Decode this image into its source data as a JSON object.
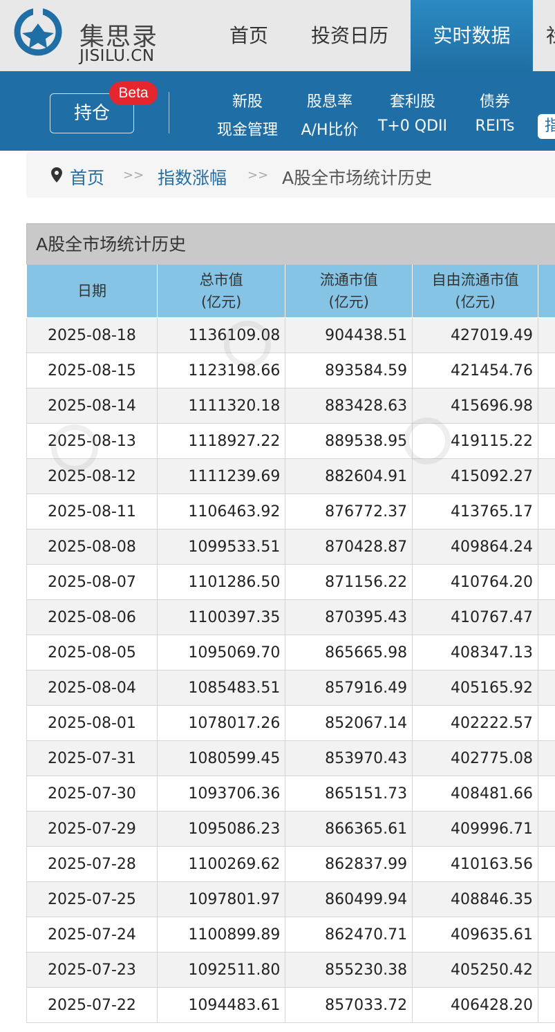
{
  "brand": {
    "name_cn": "集思录",
    "name_en": "JISILU.CN"
  },
  "top_nav": [
    {
      "label": "首页",
      "active": false
    },
    {
      "label": "投资日历",
      "active": false
    },
    {
      "label": "实时数据",
      "active": true
    },
    {
      "label": "社",
      "active": false
    }
  ],
  "sub_nav": {
    "hold_button": "持仓",
    "beta_badge": "Beta",
    "row1": [
      "新股",
      "股息率",
      "套利股",
      "债券"
    ],
    "row2": [
      "现金管理",
      "A/H比价",
      "T+0 QDII",
      "REITs"
    ],
    "pill": "指"
  },
  "breadcrumb": {
    "home": "首页",
    "sep": ">>",
    "section": "指数涨幅",
    "current": "A股全市场统计历史"
  },
  "table": {
    "caption": "A股全市场统计历史",
    "headers": [
      {
        "line1": "日期",
        "line2": ""
      },
      {
        "line1": "总市值",
        "line2": "(亿元)"
      },
      {
        "line1": "流通市值",
        "line2": "(亿元)"
      },
      {
        "line1": "自由流通市值",
        "line2": "(亿元)"
      }
    ],
    "rows": [
      [
        "2025-08-18",
        "1136109.08",
        "904438.51",
        "427019.49"
      ],
      [
        "2025-08-15",
        "1123198.66",
        "893584.59",
        "421454.76"
      ],
      [
        "2025-08-14",
        "1111320.18",
        "883428.63",
        "415696.98"
      ],
      [
        "2025-08-13",
        "1118927.22",
        "889538.95",
        "419115.22"
      ],
      [
        "2025-08-12",
        "1111239.69",
        "882604.91",
        "415092.27"
      ],
      [
        "2025-08-11",
        "1106463.92",
        "876772.37",
        "413765.17"
      ],
      [
        "2025-08-08",
        "1099533.51",
        "870428.87",
        "409864.24"
      ],
      [
        "2025-08-07",
        "1101286.50",
        "871156.22",
        "410764.20"
      ],
      [
        "2025-08-06",
        "1100397.35",
        "870395.43",
        "410767.47"
      ],
      [
        "2025-08-05",
        "1095069.70",
        "865665.98",
        "408347.13"
      ],
      [
        "2025-08-04",
        "1085483.51",
        "857916.49",
        "405165.92"
      ],
      [
        "2025-08-01",
        "1078017.26",
        "852067.14",
        "402222.57"
      ],
      [
        "2025-07-31",
        "1080599.45",
        "853970.43",
        "402775.08"
      ],
      [
        "2025-07-30",
        "1093706.36",
        "865151.73",
        "408481.66"
      ],
      [
        "2025-07-29",
        "1095086.23",
        "866365.61",
        "409996.71"
      ],
      [
        "2025-07-28",
        "1100269.62",
        "862837.99",
        "410163.56"
      ],
      [
        "2025-07-25",
        "1097801.97",
        "860499.94",
        "408846.35"
      ],
      [
        "2025-07-24",
        "1100899.89",
        "862470.71",
        "409635.61"
      ],
      [
        "2025-07-23",
        "1092511.80",
        "855230.38",
        "405250.42"
      ],
      [
        "2025-07-22",
        "1094483.61",
        "857033.72",
        "406428.20"
      ]
    ]
  },
  "colors": {
    "brand_blue": "#1f6ea5",
    "active_tab": "#2c8ac2",
    "header_cell": "#85c4e4",
    "beta_red": "#e6262e"
  }
}
